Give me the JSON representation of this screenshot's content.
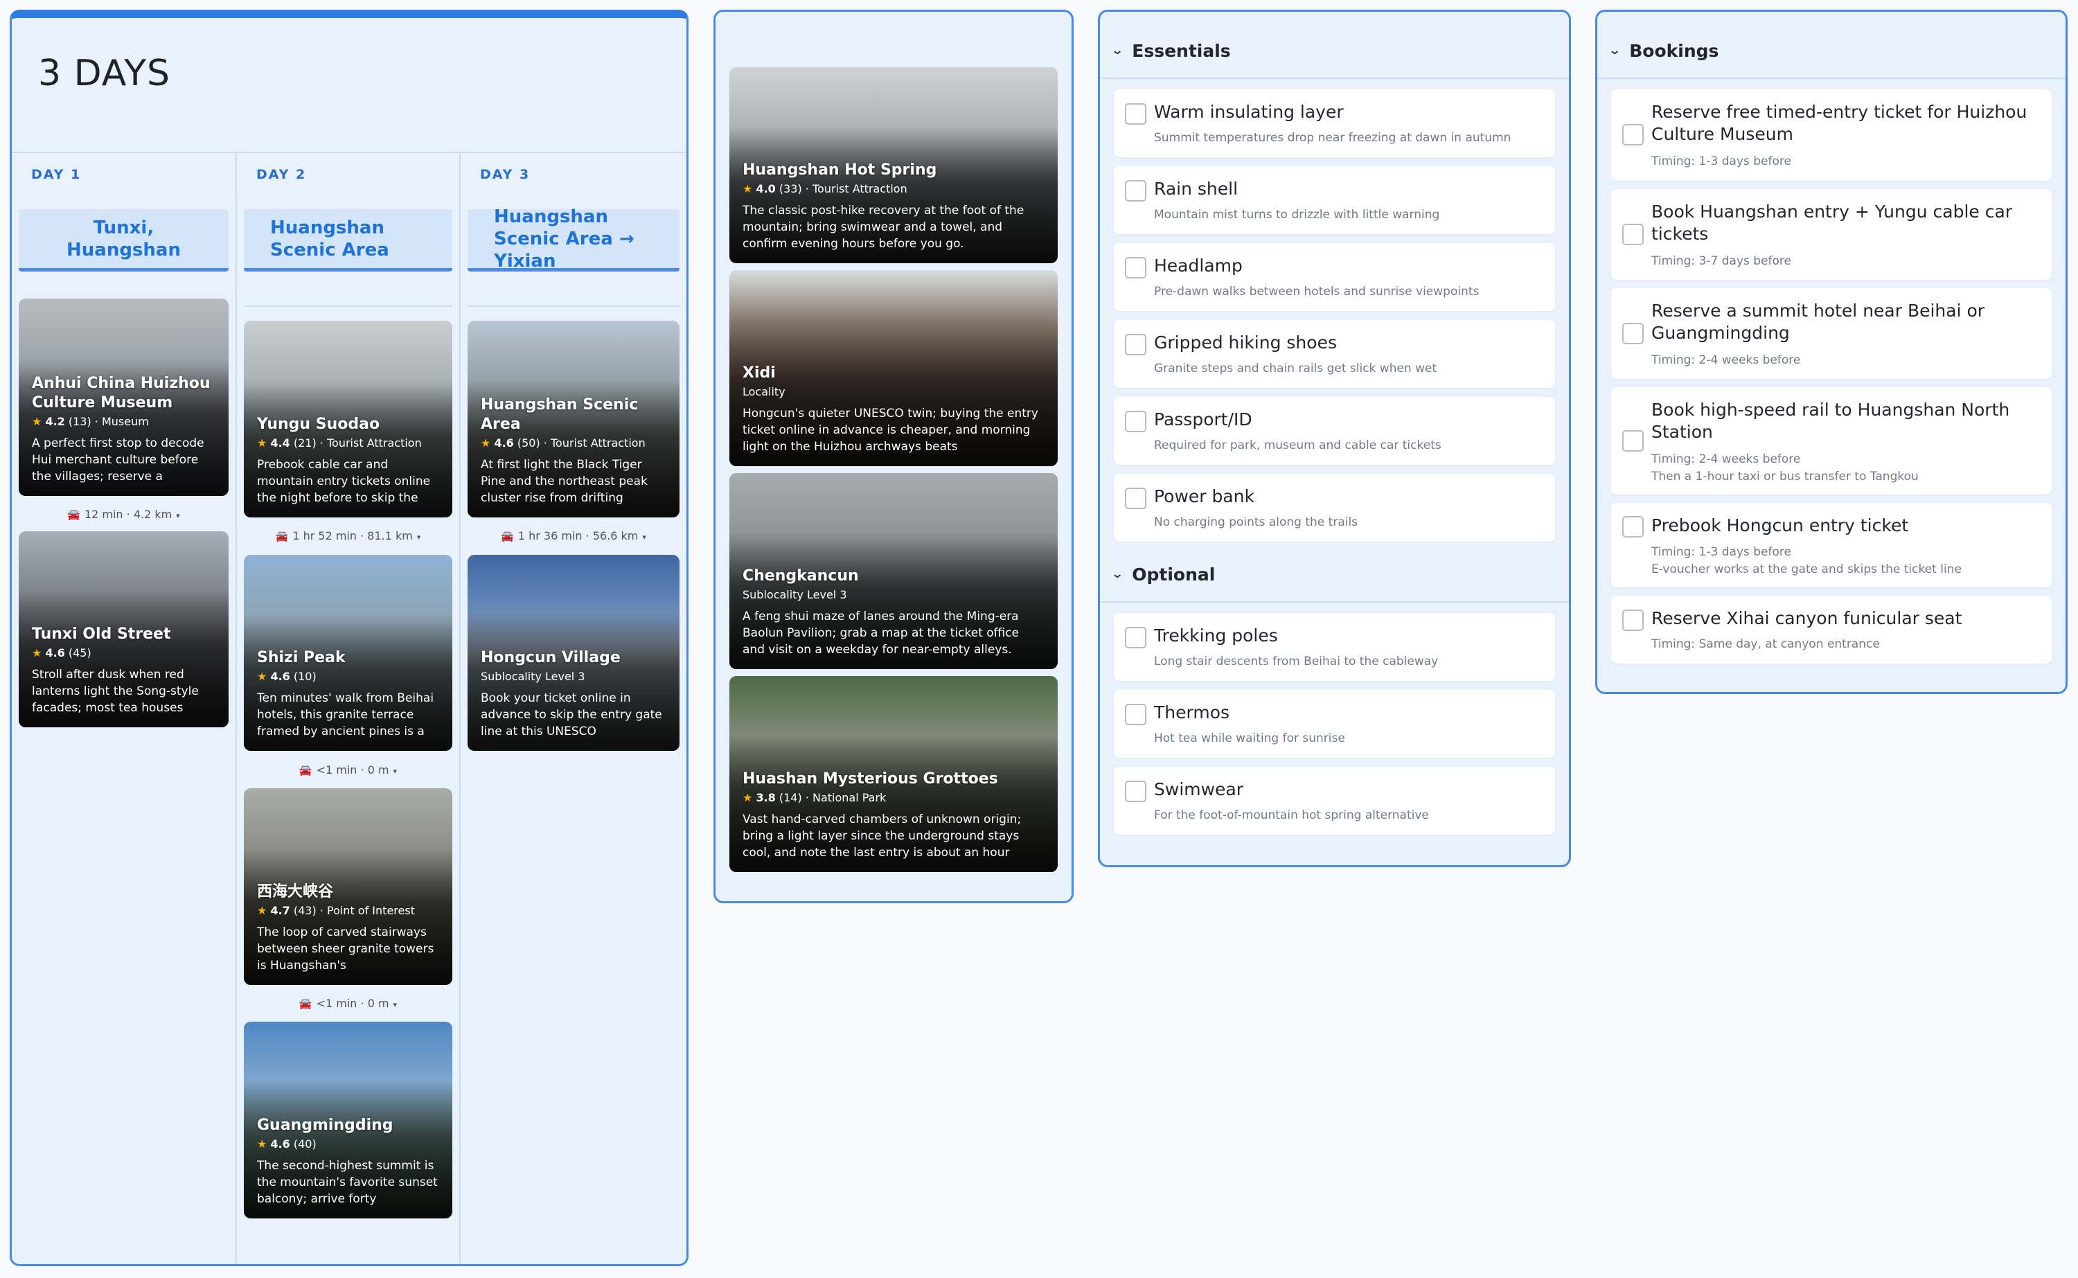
{
  "trip": {
    "title": "3 DAYS",
    "days": [
      {
        "label": "DAY 1",
        "location": "Tunxi, Huangshan",
        "places": [
          {
            "name": "Anhui China Huizhou Culture Museum",
            "rating": "4.2",
            "reviews": "(13)",
            "category": "Museum",
            "description": "A perfect first stop to decode Hui merchant culture before the villages; reserve a"
          },
          {
            "name": "Tunxi Old Street",
            "rating": "4.6",
            "reviews": "(45)",
            "category": "",
            "description": "Stroll after dusk when red lanterns light the Song-style facades; most tea houses"
          }
        ],
        "travel": [
          "12 min · 4.2 km"
        ]
      },
      {
        "label": "DAY 2",
        "location": "Huangshan Scenic Area",
        "places": [
          {
            "name": "Yungu Suodao",
            "rating": "4.4",
            "reviews": "(21)",
            "category": "Tourist Attraction",
            "description": "Prebook cable car and mountain entry tickets online the night before to skip the"
          },
          {
            "name": "Shizi Peak",
            "rating": "4.6",
            "reviews": "(10)",
            "category": "",
            "description": "Ten minutes' walk from Beihai hotels, this granite terrace framed by ancient pines is a"
          },
          {
            "name": "西海大峡谷",
            "rating": "4.7",
            "reviews": "(43)",
            "category": "Point of Interest",
            "description": "The loop of carved stairways between sheer granite towers is Huangshan's"
          },
          {
            "name": "Guangmingding",
            "rating": "4.6",
            "reviews": "(40)",
            "category": "",
            "description": "The second-highest summit is the mountain's favorite sunset balcony; arrive forty"
          }
        ],
        "travel": [
          "1 hr 52 min · 81.1 km",
          "<1 min · 0 m",
          "<1 min · 0 m"
        ]
      },
      {
        "label": "DAY 3",
        "location": "Huangshan Scenic Area → Yixian",
        "places": [
          {
            "name": "Huangshan Scenic Area",
            "rating": "4.6",
            "reviews": "(50)",
            "category": "Tourist Attraction",
            "description": "At first light the Black Tiger Pine and the northeast peak cluster rise from drifting"
          },
          {
            "name": "Hongcun Village",
            "subtitle": "Sublocality Level 3",
            "description": "Book your ticket online in advance to skip the entry gate line at this UNESCO"
          }
        ],
        "travel": [
          "1 hr 36 min · 56.6 km"
        ]
      }
    ]
  },
  "ideas": [
    {
      "name": "Huangshan Hot Spring",
      "rating": "4.0",
      "reviews": "(33)",
      "category": "Tourist Attraction",
      "description": "The classic post-hike recovery at the foot of the mountain; bring swimwear and a towel, and confirm evening hours before you go."
    },
    {
      "name": "Xidi",
      "subtitle": "Locality",
      "description": "Hongcun's quieter UNESCO twin; buying the entry ticket online in advance is cheaper, and morning light on the Huizhou archways beats"
    },
    {
      "name": "Chengkancun",
      "subtitle": "Sublocality Level 3",
      "description": "A feng shui maze of lanes around the Ming-era Baolun Pavilion; grab a map at the ticket office and visit on a weekday for near-empty alleys."
    },
    {
      "name": "Huashan Mysterious Grottoes",
      "rating": "3.8",
      "reviews": "(14)",
      "category": "National Park",
      "description": "Vast hand-carved chambers of unknown origin; bring a light layer since the underground stays cool, and note the last entry is about an hour"
    }
  ],
  "essentials": {
    "header": "Essentials",
    "items": [
      {
        "title": "Warm insulating layer",
        "note": "Summit temperatures drop near freezing at dawn in autumn"
      },
      {
        "title": "Rain shell",
        "note": "Mountain mist turns to drizzle with little warning"
      },
      {
        "title": "Headlamp",
        "note": "Pre-dawn walks between hotels and sunrise viewpoints"
      },
      {
        "title": "Gripped hiking shoes",
        "note": "Granite steps and chain rails get slick when wet"
      },
      {
        "title": "Passport/ID",
        "note": "Required for park, museum and cable car tickets"
      },
      {
        "title": "Power bank",
        "note": "No charging points along the trails"
      }
    ]
  },
  "optional": {
    "header": "Optional",
    "items": [
      {
        "title": "Trekking poles",
        "note": "Long stair descents from Beihai to the cableway"
      },
      {
        "title": "Thermos",
        "note": "Hot tea while waiting for sunrise"
      },
      {
        "title": "Swimwear",
        "note": "For the foot-of-mountain hot spring alternative"
      }
    ]
  },
  "bookings": {
    "header": "Bookings",
    "items": [
      {
        "title": "Reserve free timed-entry ticket for Huizhou Culture Museum",
        "timing": "Timing: 1-3 days before"
      },
      {
        "title": "Book Huangshan entry + Yungu cable car tickets",
        "timing": "Timing: 3-7 days before"
      },
      {
        "title": "Reserve a summit hotel near Beihai or Guangmingding",
        "timing": "Timing: 2-4 weeks before"
      },
      {
        "title": "Book high-speed rail to Huangshan North Station",
        "timing": "Timing: 2-4 weeks before",
        "note": "Then a 1-hour taxi or bus transfer to Tangkou"
      },
      {
        "title": "Prebook Hongcun entry ticket",
        "timing": "Timing: 1-3 days before",
        "note": "E-voucher works at the gate and skips the ticket line"
      },
      {
        "title": "Reserve Xihai canyon funicular seat",
        "timing": "Timing: Same day, at canyon entrance"
      }
    ]
  },
  "icons": {
    "travel": "car-icon",
    "expand": "chevron-down-icon",
    "dropdown": "caret-down-icon",
    "rating": "star-icon"
  },
  "colors": {
    "accent": "#2f7be3",
    "panel": "#e9f1fc",
    "star": "#f5b400",
    "location_text": "#1e73d6"
  }
}
